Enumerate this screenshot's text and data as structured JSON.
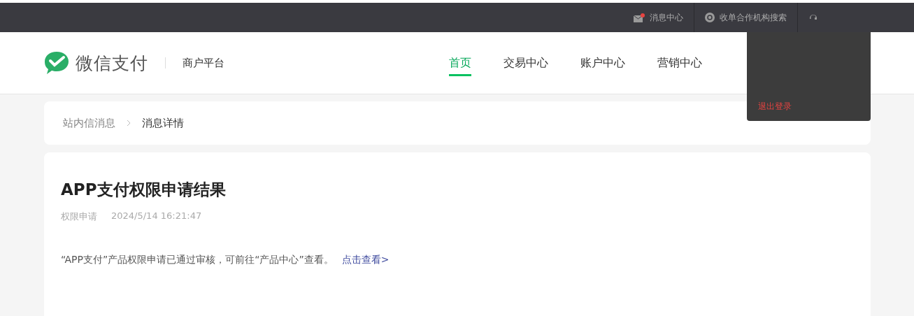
{
  "top_bar": {
    "items": [
      {
        "kind": "message",
        "label": "消息中心",
        "unread": true
      },
      {
        "kind": "search",
        "label": "收单合作机构搜索"
      },
      {
        "kind": "help"
      }
    ],
    "dropdown": {
      "items": [
        "退出登录"
      ]
    }
  },
  "header": {
    "brand": "微信支付",
    "platform": "商户平台",
    "nav": [
      {
        "label": "首页",
        "selected": true
      },
      {
        "label": "交易中心",
        "selected": false
      },
      {
        "label": "账户中心",
        "selected": false
      },
      {
        "label": "营销中心",
        "selected": false
      }
    ]
  },
  "breadcrumb": [
    "站内信消息",
    "消息详情"
  ],
  "message": {
    "title": "APP支付权限申请结果",
    "category": "权限申请",
    "time": "2024/5/14 16:21:47",
    "body": "“APP支付”产品权限申请已通过审核，可前往“产品中心”查看。",
    "link": "点击查看>"
  }
}
